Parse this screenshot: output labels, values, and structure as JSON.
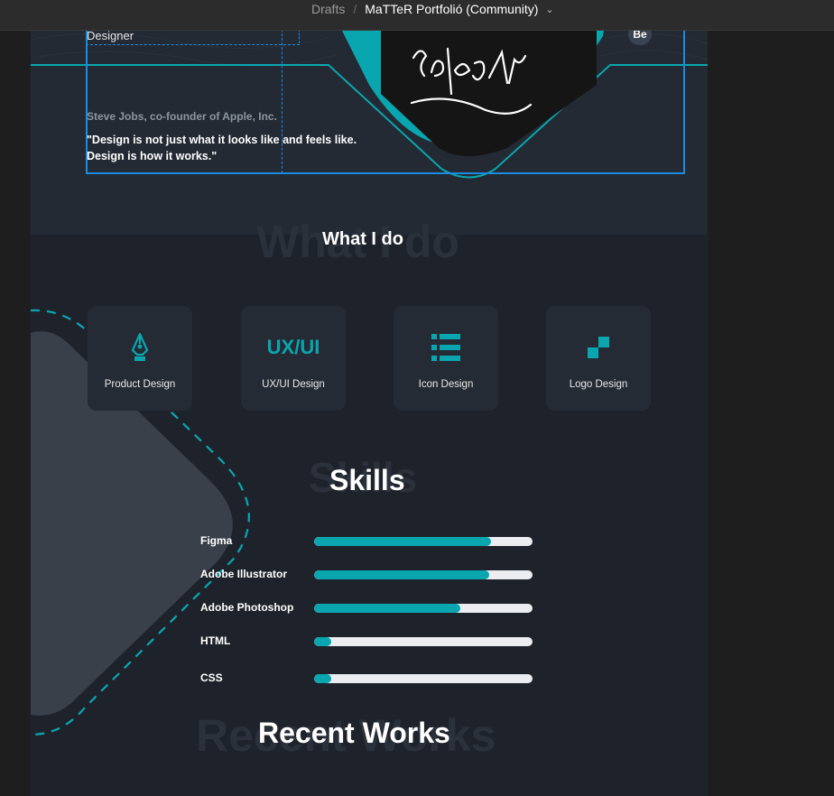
{
  "topbar": {
    "breadcrumb": "Drafts",
    "separator": "/",
    "file_title": "MaTTeR Portfolió (Community)",
    "chevron": "⌄"
  },
  "hero": {
    "role": "Designer",
    "behance_badge": "Be",
    "quote_author": "Steve Jobs, co-founder of Apple, Inc.",
    "quote": "\"Design is not just what it looks like and feels like. Design is how it works.\"",
    "signature": "Sölfes Fix",
    "accent_color": "#0aa6b0"
  },
  "what_i_do": {
    "bg_text": "What I do",
    "title": "What I do",
    "services": [
      {
        "label": "Product Design",
        "icon": "pen-nib-icon"
      },
      {
        "label": "UX/UI Design",
        "icon": "ux-ui-text-icon",
        "icon_text": "UX/UI"
      },
      {
        "label": "Icon Design",
        "icon": "list-icon"
      },
      {
        "label": "Logo Design",
        "icon": "pixel-logo-icon"
      }
    ]
  },
  "skills": {
    "bg_text": "Skills",
    "title": "Skills",
    "items": [
      {
        "name": "Figma",
        "level": 0.81
      },
      {
        "name": "Adobe Illustrator",
        "level": 0.8
      },
      {
        "name": "Adobe Photoshop",
        "level": 0.67
      },
      {
        "name": "HTML",
        "level": 0.08
      },
      {
        "name": "CSS",
        "level": 0.08
      }
    ]
  },
  "recent_works": {
    "bg_text": "Recent Works",
    "title": "Recent Works"
  }
}
